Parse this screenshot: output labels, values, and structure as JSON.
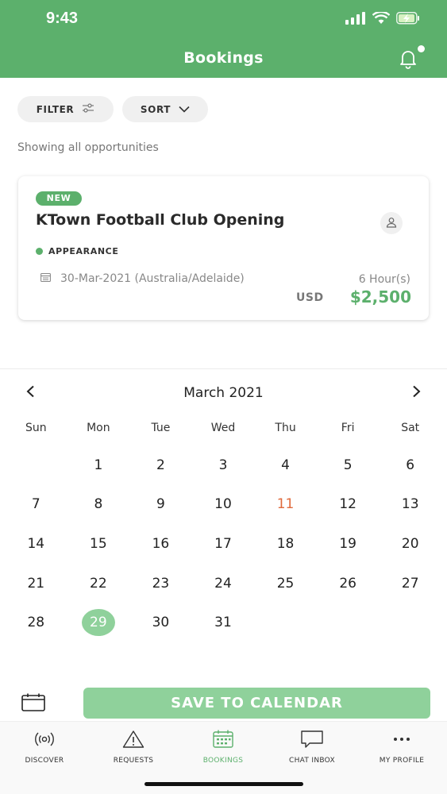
{
  "status_bar": {
    "time": "9:43"
  },
  "header": {
    "title": "Bookings"
  },
  "toolbar": {
    "filter_label": "FILTER",
    "sort_label": "SORT"
  },
  "showing_text": "Showing all opportunities",
  "booking": {
    "badge": "NEW",
    "title": "KTown Football Club Opening",
    "type": "APPEARANCE",
    "date": "30-Mar-2021 (Australia/Adelaide)",
    "duration": "6 Hour(s)",
    "currency": "USD",
    "price": "$2,500"
  },
  "calendar": {
    "month_label": "March 2021",
    "weekdays": [
      "Sun",
      "Mon",
      "Tue",
      "Wed",
      "Thu",
      "Fri",
      "Sat"
    ],
    "leading_blanks": 1,
    "days_in_month": 31,
    "today": 11,
    "selected": 29
  },
  "save_button_label": "SAVE TO CALENDAR",
  "tabs": [
    {
      "label": "DISCOVER",
      "icon": "broadcast-icon",
      "active": false
    },
    {
      "label": "REQUESTS",
      "icon": "warning-icon",
      "active": false
    },
    {
      "label": "BOOKINGS",
      "icon": "calendar-grid-icon",
      "active": true
    },
    {
      "label": "CHAT INBOX",
      "icon": "chat-bubble-icon",
      "active": false
    },
    {
      "label": "MY PROFILE",
      "icon": "more-dots-icon",
      "active": false
    }
  ],
  "colors": {
    "brand_green": "#5cb06c",
    "light_green": "#8fd19b",
    "today_orange": "#e06a3c"
  }
}
